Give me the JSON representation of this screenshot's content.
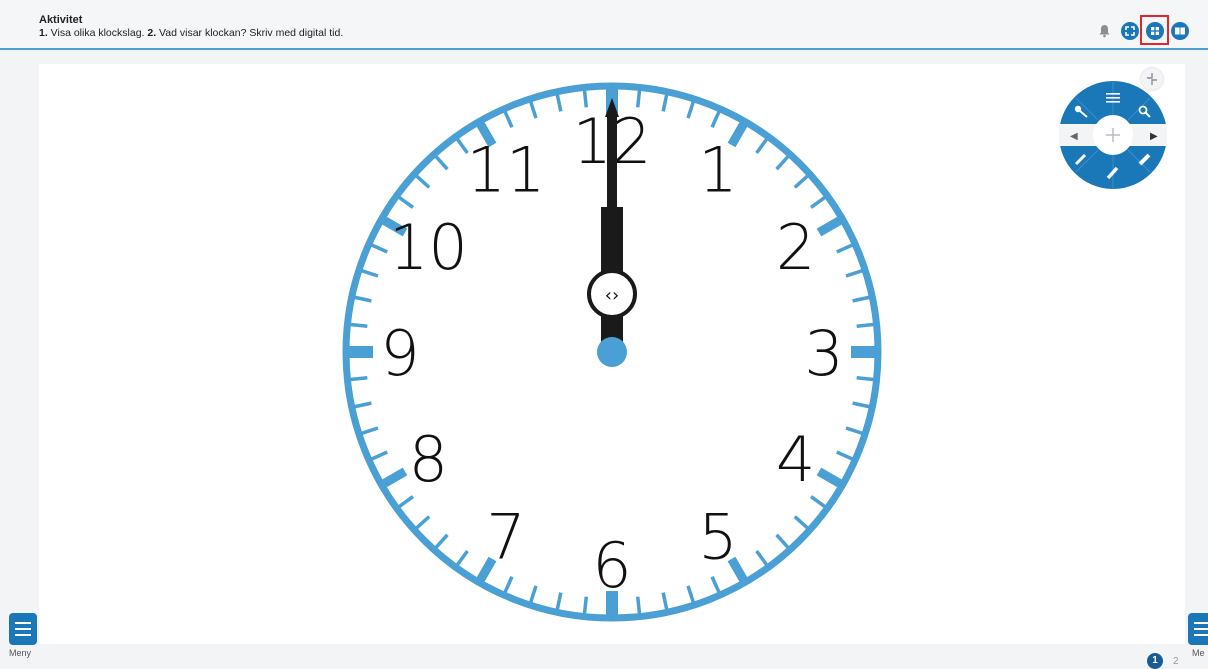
{
  "header": {
    "title": "Aktivitet",
    "step1_num": "1.",
    "step1_text": " Visa olika klockslag. ",
    "step2_num": "2.",
    "step2_text": " Vad visar klockan? Skriv med digital tid."
  },
  "toolbar": {
    "icons": [
      "bell-icon",
      "fullscreen-icon",
      "grid-icon",
      "book-icon"
    ],
    "selected": "grid-icon",
    "accent": "#1a77b8",
    "highlight": "#e0272f"
  },
  "clock": {
    "numbers": [
      "12",
      "1",
      "2",
      "3",
      "4",
      "5",
      "6",
      "7",
      "8",
      "9",
      "10",
      "11"
    ],
    "hour_hand_points_to": "12",
    "minute_hand_points_to": "12",
    "ring_color": "#4a9fd5",
    "hand_color": "#1a1a1a",
    "center_dot_color": "#4a9fd5"
  },
  "tool_wheel": {
    "icons": [
      "key-icon",
      "list-icon",
      "zoom-icon",
      "left-arrow-icon",
      "move-icon",
      "right-arrow-icon",
      "pen-icon",
      "marker-icon",
      "eraser-icon"
    ],
    "left_glyph": "◀",
    "right_glyph": "▶",
    "color": "#1a77b8"
  },
  "footer": {
    "menu_left": "Meny",
    "menu_right": "Me",
    "page_current": "1",
    "page_other": "2"
  }
}
